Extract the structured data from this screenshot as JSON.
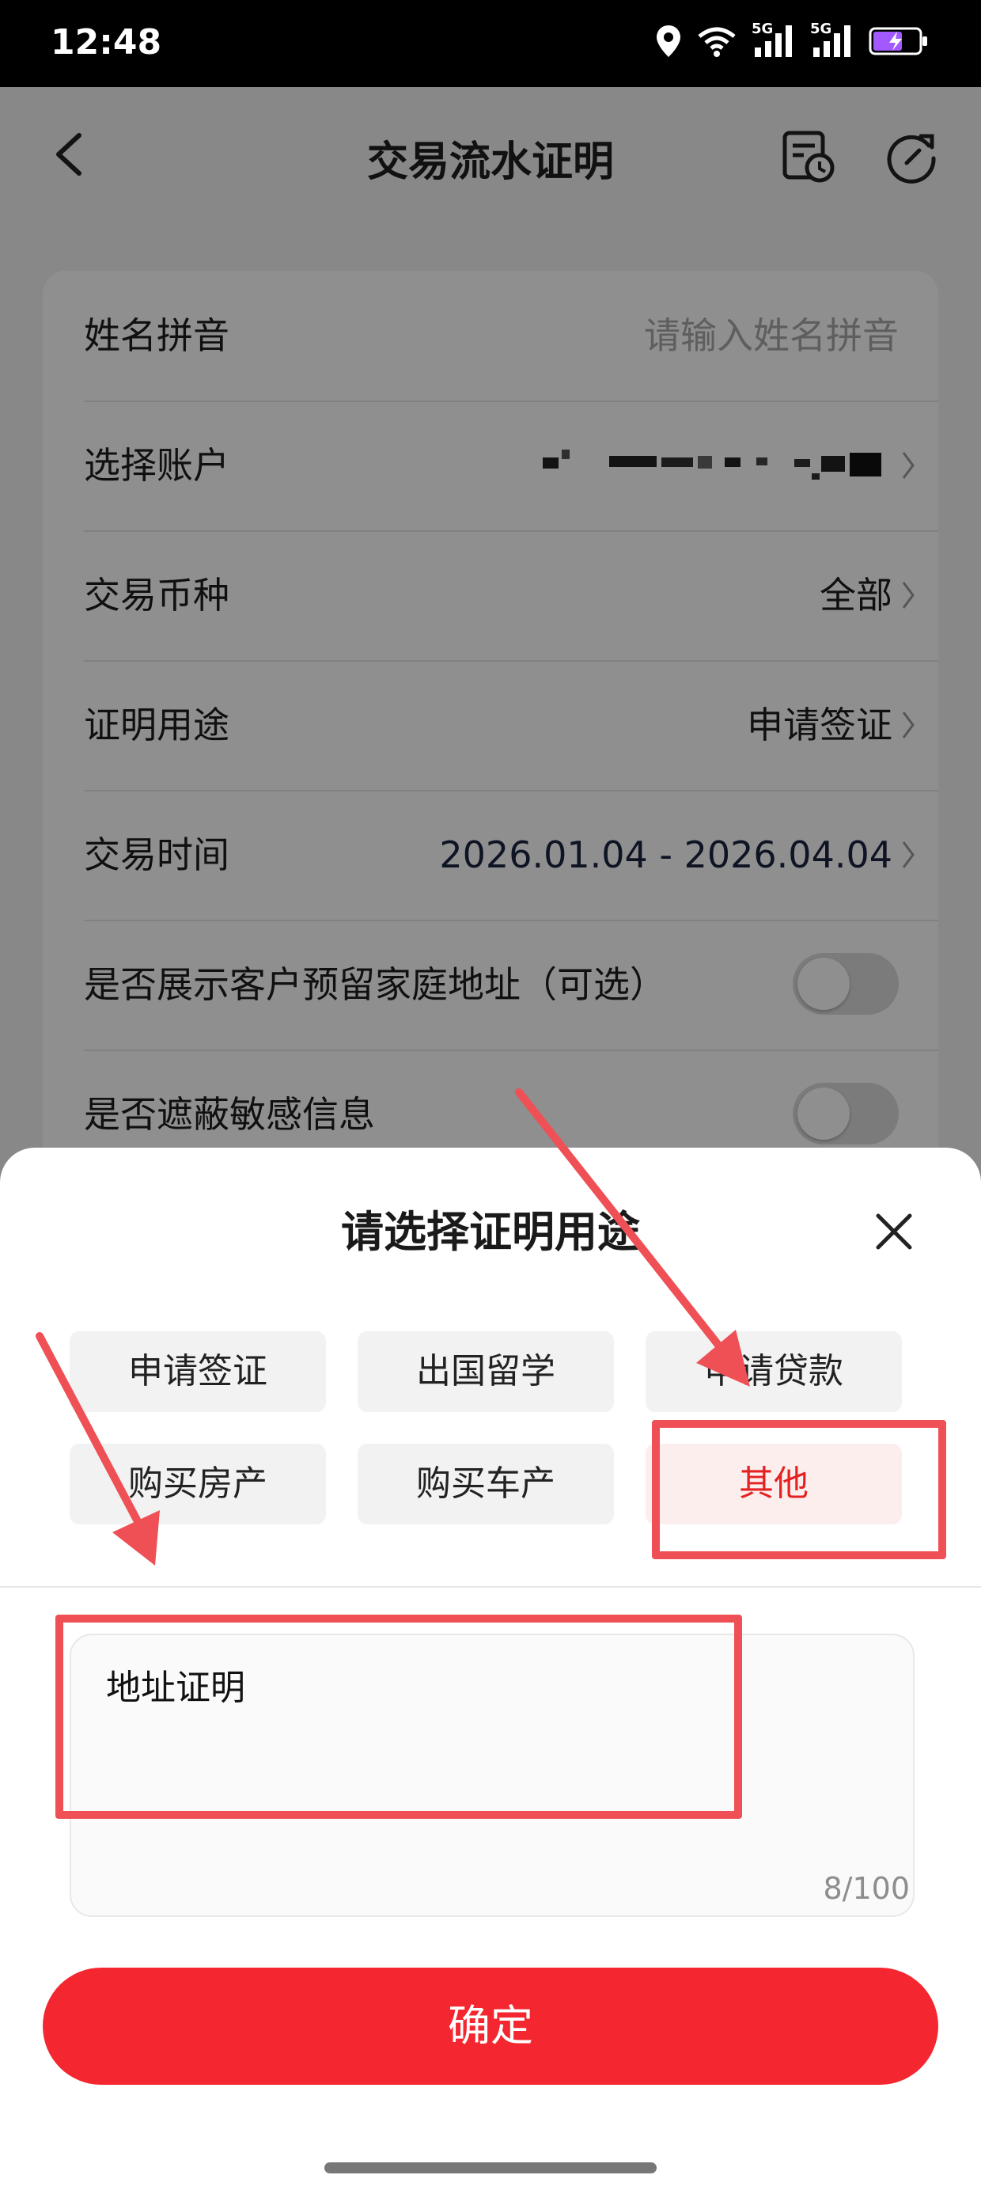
{
  "status_bar": {
    "time": "12:48",
    "network_label": "5G"
  },
  "nav": {
    "title": "交易流水证明",
    "icons": [
      "back-icon",
      "history-icon",
      "refresh-icon"
    ]
  },
  "form": {
    "name_label": "姓名拼音",
    "name_placeholder": "请输入姓名拼音",
    "account_label": "选择账户",
    "currency_label": "交易币种",
    "currency_value": "全部",
    "purpose_label": "证明用途",
    "purpose_value": "申请签证",
    "time_label": "交易时间",
    "time_value": "2026.01.04 - 2026.04.04",
    "address_toggle_label": "是否展示客户预留家庭地址（可选）",
    "mask_toggle_label": "是否遮蔽敏感信息"
  },
  "sheet": {
    "title": "请选择证明用途",
    "options": [
      "申请签证",
      "出国留学",
      "申请贷款",
      "购买房产",
      "购买车产",
      "其他"
    ],
    "selected_option": "其他",
    "text_value": "地址证明",
    "counter": "8/100",
    "confirm_label": "确定"
  },
  "colors": {
    "accent": "#f4262f",
    "selected_text": "#e52222",
    "annotation": "#ef5055"
  }
}
